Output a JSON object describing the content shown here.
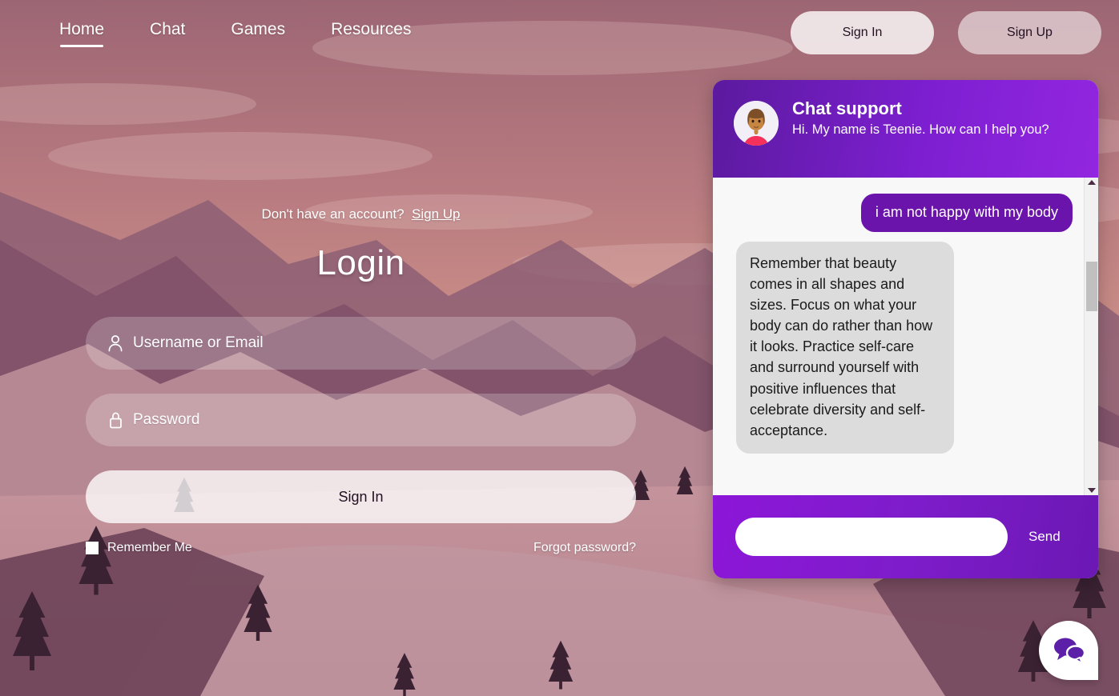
{
  "nav": {
    "items": [
      {
        "label": "Home",
        "active": true
      },
      {
        "label": "Chat",
        "active": false
      },
      {
        "label": "Games",
        "active": false
      },
      {
        "label": "Resources",
        "active": false
      }
    ],
    "sign_in_label": "Sign In",
    "sign_up_label": "Sign Up"
  },
  "login": {
    "account_prompt": "Don't have an account?",
    "account_link": "Sign Up",
    "title": "Login",
    "username_placeholder": "Username or Email",
    "username_value": "",
    "username_icon": "person-icon",
    "password_placeholder": "Password",
    "password_value": "",
    "password_icon": "lock-icon",
    "submit_label": "Sign In",
    "remember_label": "Remember Me",
    "remember_checked": false,
    "forgot_label": "Forgot password?"
  },
  "chat": {
    "title": "Chat support",
    "greeting": "Hi. My name is Teenie. How can I help you?",
    "avatar_icon": "woman-avatar-icon",
    "messages": [
      {
        "from": "user",
        "text": "i am not happy with my body"
      },
      {
        "from": "bot",
        "text": "Remember that beauty comes in all shapes and sizes. Focus on what your body can do rather than how it looks. Practice self-care and surround yourself with positive influences that celebrate diversity and self-acceptance."
      }
    ],
    "input_value": "",
    "input_placeholder": "",
    "send_label": "Send",
    "scrollbar": {
      "up_icon": "caret-up-icon",
      "down_icon": "caret-down-icon"
    }
  },
  "fab": {
    "icon": "chat-bubbles-icon"
  },
  "colors": {
    "chat_purple_dark": "#5b1a9e",
    "chat_purple_light": "#9326e0",
    "user_bubble": "#6b14ab",
    "bot_bubble": "#dcdcdc",
    "accent_white": "#ffffff",
    "sky_top": "#a9707f",
    "sky_mid": "#d08f86"
  }
}
